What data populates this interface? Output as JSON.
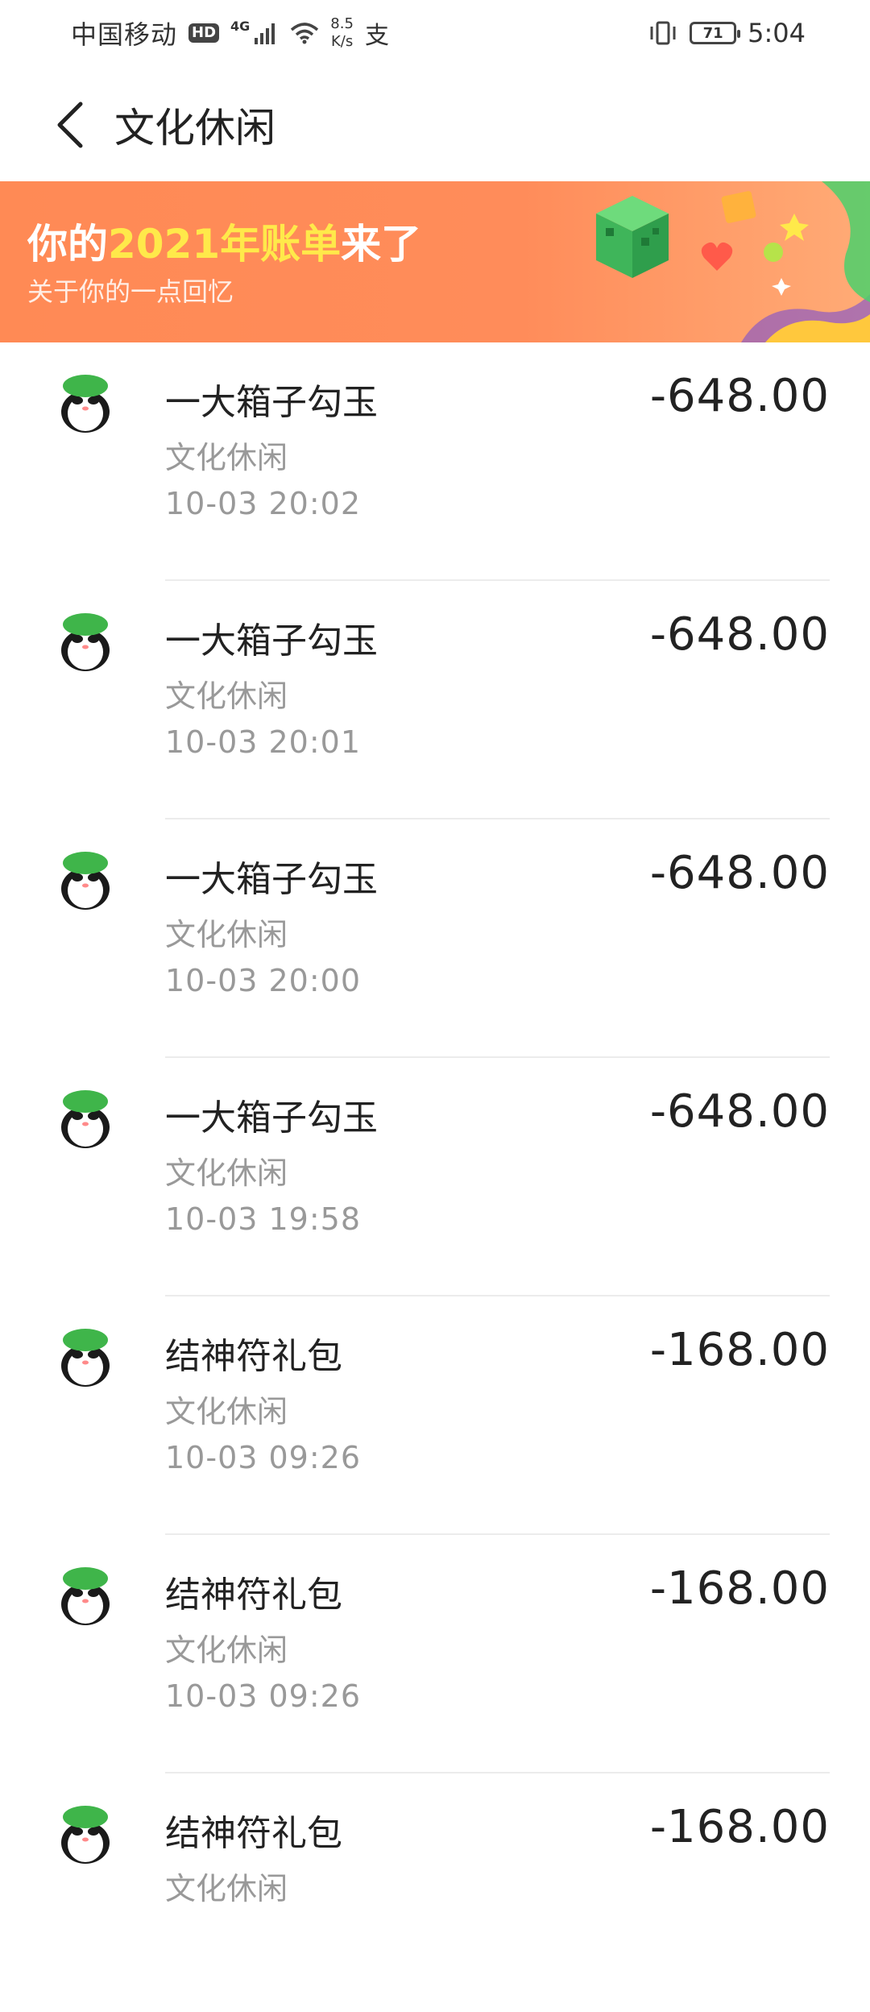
{
  "status_bar": {
    "carrier": "中国移动",
    "hd": "HD",
    "network": "4G",
    "speed_value": "8.5",
    "speed_unit": "K/s",
    "alipay_glyph": "支",
    "battery": "71",
    "time": "5:04"
  },
  "header": {
    "title": "文化休闲",
    "back_icon": "chevron-left-icon"
  },
  "banner": {
    "title_prefix": "你的",
    "title_highlight": "2021年账单",
    "title_suffix": "来了",
    "subtitle": "关于你的一点回忆",
    "highlight_color": "#ffe94a",
    "background_color": "#ff8a55"
  },
  "transactions": [
    {
      "title": "一大箱子勾玉",
      "category": "文化休闲",
      "time": "10-03  20:02",
      "amount": "-648.00"
    },
    {
      "title": "一大箱子勾玉",
      "category": "文化休闲",
      "time": "10-03  20:01",
      "amount": "-648.00"
    },
    {
      "title": "一大箱子勾玉",
      "category": "文化休闲",
      "time": "10-03  20:00",
      "amount": "-648.00"
    },
    {
      "title": "一大箱子勾玉",
      "category": "文化休闲",
      "time": "10-03  19:58",
      "amount": "-648.00"
    },
    {
      "title": "结神符礼包",
      "category": "文化休闲",
      "time": "10-03  09:26",
      "amount": "-168.00"
    },
    {
      "title": "结神符礼包",
      "category": "文化休闲",
      "time": "10-03  09:26",
      "amount": "-168.00"
    },
    {
      "title": "结神符礼包",
      "category": "文化休闲",
      "time": "",
      "amount": "-168.00"
    }
  ]
}
